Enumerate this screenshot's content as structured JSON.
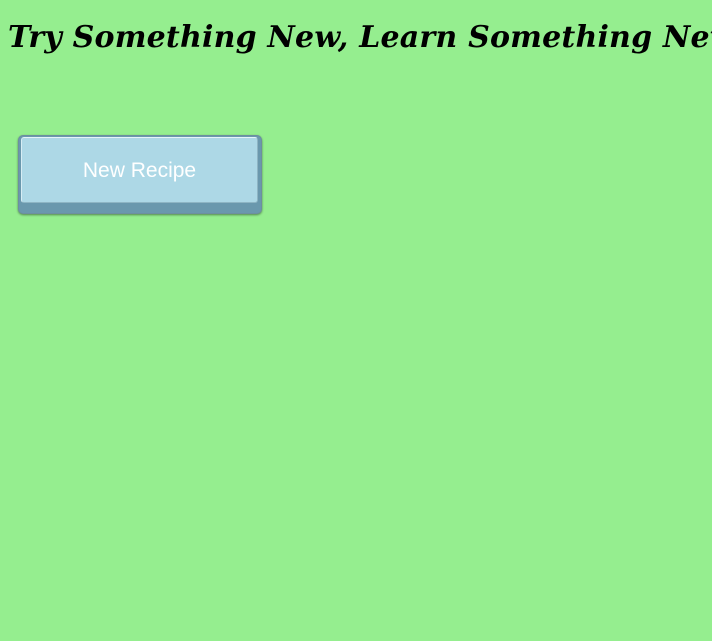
{
  "page": {
    "title": "Try Something New, Learn Something New",
    "background_color": "#95ee8f"
  },
  "main": {
    "new_recipe_button": {
      "label": "New Recipe",
      "face_color": "#add8e6",
      "shadow_color": "#6a98ad",
      "text_color": "#ffffff"
    }
  }
}
